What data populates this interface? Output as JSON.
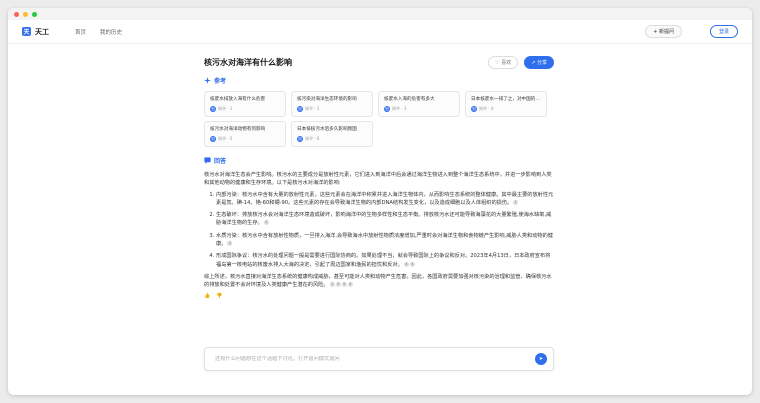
{
  "window": {
    "dots": [
      "#ff5f57",
      "#febc2e",
      "#28c840"
    ]
  },
  "nav": {
    "logo_glyph": "天",
    "brand": "天工",
    "links": [
      "首页",
      "我的历史"
    ],
    "new_question": "+ 新提问",
    "login": "登录"
  },
  "question": {
    "title": "核污水对海洋有什么影响",
    "like_label": "♡ 喜欢",
    "share_label": "↗ 分享"
  },
  "references": {
    "heading": "参考",
    "icon": "sparkle-icon",
    "items": [
      {
        "title": "核废水排放入海有什么危害",
        "source": "知乎 · 1",
        "badge": "知"
      },
      {
        "title": "核污染对海洋生态环境的影响",
        "source": "知乎 · 2",
        "badge": "知"
      },
      {
        "title": "核废水入海的危害有多大",
        "source": "知乎 · 3",
        "badge": "知"
      },
      {
        "title": "日本核废水一排了之，对中国的影响",
        "source": "知乎 · 4",
        "badge": "知"
      },
      {
        "title": "核污水对海洋动物有何影响",
        "source": "知乎 · 5",
        "badge": "知"
      },
      {
        "title": "日本排核污水后多久影响我国",
        "source": "知乎 · 6",
        "badge": "知"
      }
    ]
  },
  "answer": {
    "heading": "回答",
    "icon": "chat-icon",
    "intro": "核污水对海洋生态会产生影响。核污水的主要成分是放射性元素，它们进入到海洋中后会通过海洋生物进入到整个海洋生态系统中，并进一步影响到人类和其他动物的健康和生存环境。以下是核污水对海洋的影响:",
    "points": [
      {
        "text": "内部污染：核污水中含有大量的放射性元素，这些元素会在海洋中积累并进入海洋生物体内，从而影响生态系统的整体健康。其中最主要的放射性元素是氚、碘-14、铯-60和锶-90。这些元素的存在会导致海洋生物的内部DNA结构发生变化，以及造成细胞以及人体组织的损伤。",
        "cites": [
          "1"
        ]
      },
      {
        "text": "生态破坏：排放核污水会对海洋生态环境造成破坏，影响海洋中的生物多样性和生态平衡。排放核污水还可能导致海藻花的大量繁殖,使海水缺氧,威胁海洋生物的生存。",
        "cites": [
          "2"
        ]
      },
      {
        "text": "水质污染：核污水中含有放射性物质，一旦排入海洋,会导致海水中放射性物质浓度增加,严重时会对海洋生物和食物链产生影响,威胁人类和动物的健康。",
        "cites": [
          "3"
        ]
      },
      {
        "text": "形成国际争议：核污水的处理问题一般是需要进行国际协商的。如果处理不当，就会导致国际上的争议和反对。2023年4月13日，日本政府宣布将福岛第一核电站的核废水排入大海的决定，引起了周边国家和渔民的担忧和反对。",
        "cites": [
          "4",
          "5"
        ]
      }
    ],
    "conclusion": "综上所述，核污水直接对海洋生态系统的健康构成威胁，甚至可能对人类和动物产生危害。因此，各国政府需要加强对核污染的治理和监管，确保核污水的排放和处置不会对环境及人类健康产生潜在的风险。",
    "conclusion_cites": [
      "1",
      "2",
      "3",
      "4"
    ]
  },
  "feedback": {
    "up_icon": "thumbs-up-icon",
    "down_icon": "thumbs-down-icon",
    "up": "👍",
    "down": "👎"
  },
  "input": {
    "placeholder": "还有什么问题想在这个话题下讨论。打开追问模式追问",
    "send_icon": "send-icon",
    "send_glyph": "➤"
  }
}
